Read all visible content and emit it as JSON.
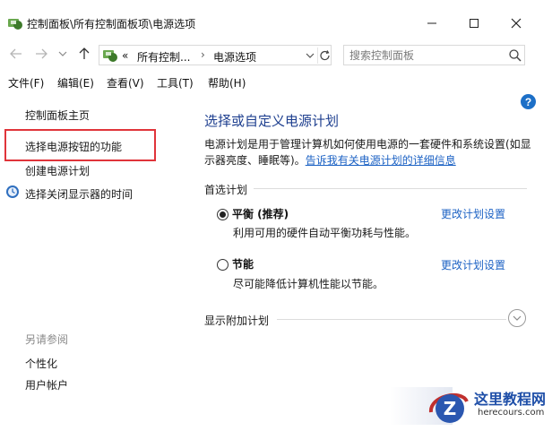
{
  "window": {
    "title": "控制面板\\所有控制面板项\\电源选项"
  },
  "address": {
    "prefix": "«",
    "crumb1": "所有控制...",
    "separator": "›",
    "crumb2": "电源选项"
  },
  "search": {
    "placeholder": "搜索控制面板"
  },
  "menu": {
    "items": [
      "文件(F)",
      "编辑(E)",
      "查看(V)",
      "工具(T)",
      "帮助(H)"
    ]
  },
  "sidebar": {
    "home": "控制面板主页",
    "links": [
      "选择电源按钮的功能",
      "创建电源计划",
      "选择关闭显示器的时间"
    ],
    "see_also_title": "另请参阅",
    "see_also": [
      "个性化",
      "用户帐户"
    ]
  },
  "main": {
    "title": "选择或自定义电源计划",
    "description_1": "电源计划是用于管理计算机如何使用电源的一套硬件和系统设置(如显示器亮度、睡眠等)。",
    "description_link": "告诉我有关电源计划的详细信息",
    "preferred_label": "首选计划",
    "plans": [
      {
        "name": "平衡 (推荐)",
        "desc": "利用可用的硬件自动平衡功耗与性能。",
        "link": "更改计划设置",
        "selected": true
      },
      {
        "name": "节能",
        "desc": "尽可能降低计算机性能以节能。",
        "link": "更改计划设置",
        "selected": false
      }
    ],
    "additional_label": "显示附加计划"
  },
  "watermark": {
    "name": "这里教程网",
    "url": "herecours.com"
  },
  "colors": {
    "accent": "#1e3f8f",
    "link": "#1c62c4",
    "highlight": "#e0343a"
  }
}
